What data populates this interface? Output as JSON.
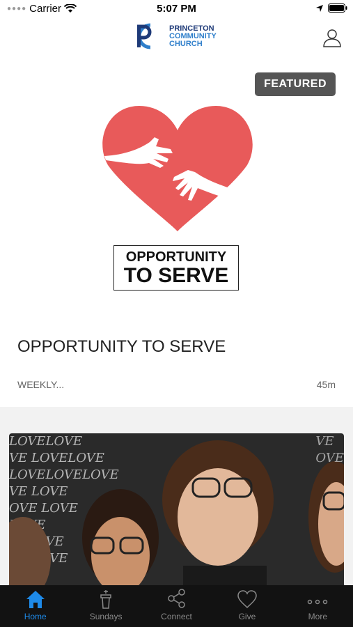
{
  "status_bar": {
    "carrier": "Carrier",
    "time": "5:07 PM"
  },
  "header": {
    "logo_line1": "PRINCETON",
    "logo_line2": "COMMUNITY",
    "logo_line3": "CHURCH",
    "logo_mark": "PC"
  },
  "featured": {
    "badge": "FEATURED",
    "art_line1": "OPPORTUNITY",
    "art_line2": "TO SERVE",
    "title": "OPPORTUNITY TO SERVE",
    "meta": "WEEKLY...",
    "duration": "45m"
  },
  "photo_card": {
    "chalk_text": [
      "LOVELOVE",
      "VE LOVELOVE",
      "LOVELOVELOVE",
      "VE LOVE",
      "OVE LOVE",
      "LOVE",
      "VELOVE",
      "VE LOVE"
    ]
  },
  "tabs": [
    {
      "label": "Home",
      "icon": "home-icon",
      "active": true
    },
    {
      "label": "Sundays",
      "icon": "pulpit-icon",
      "active": false
    },
    {
      "label": "Connect",
      "icon": "share-icon",
      "active": false
    },
    {
      "label": "Give",
      "icon": "heart-icon",
      "active": false
    },
    {
      "label": "More",
      "icon": "more-icon",
      "active": false
    }
  ],
  "colors": {
    "accent": "#1e8ae8",
    "heart": "#e85a5a",
    "tabbar": "#121212"
  }
}
